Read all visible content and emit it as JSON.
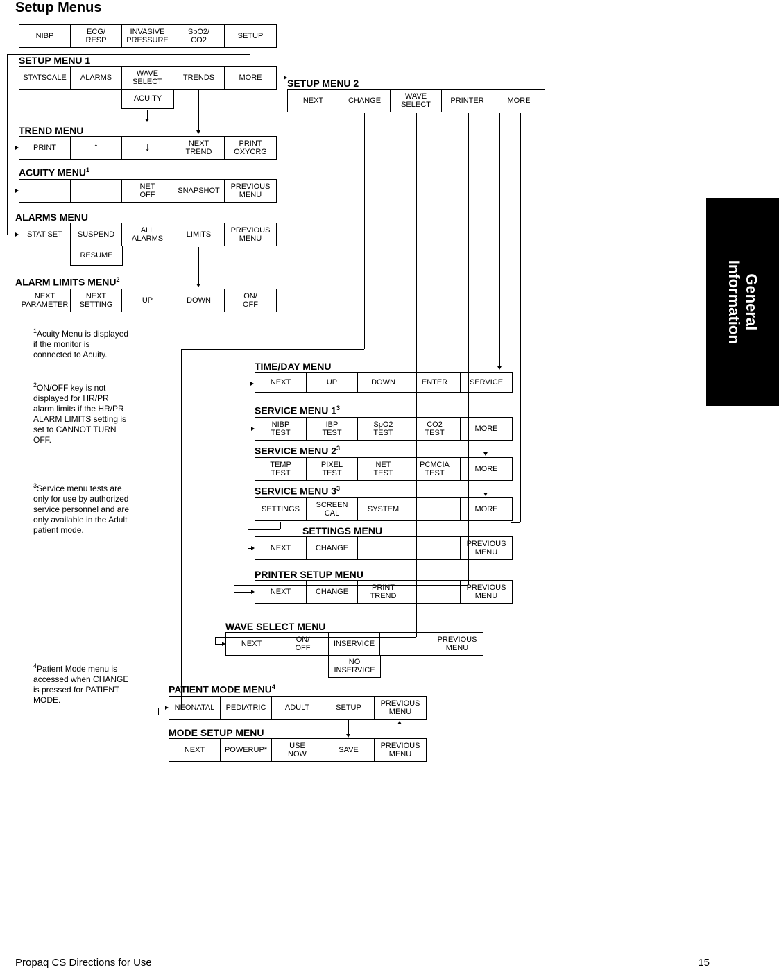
{
  "title": "Setup Menus",
  "sidebar": {
    "line1": "General",
    "line2": "Information"
  },
  "top_menu": {
    "items": [
      "NIBP",
      "ECG/\nRESP",
      "INVASIVE\nPRESSURE",
      "SpO2/\nCO2",
      "SETUP"
    ]
  },
  "setup_menu_1": {
    "header": "SETUP MENU 1",
    "items": [
      "STATSCALE",
      "ALARMS",
      "WAVE\nSELECT",
      "TRENDS",
      "MORE"
    ],
    "sub_item": "ACUITY"
  },
  "setup_menu_2": {
    "header": "SETUP MENU 2",
    "items": [
      "NEXT",
      "CHANGE",
      "WAVE\nSELECT",
      "PRINTER",
      "MORE"
    ]
  },
  "trend_menu": {
    "header": "TREND MENU",
    "items": [
      "PRINT",
      "↑",
      "↓",
      "NEXT\nTREND",
      "PRINT\nOXYCRG"
    ]
  },
  "acuity_menu": {
    "header_pre": "ACUITY MENU",
    "header_sup": "1",
    "items": [
      "",
      "",
      "NET\nOFF",
      "SNAPSHOT",
      "PREVIOUS\nMENU"
    ]
  },
  "alarms_menu": {
    "header": "ALARMS MENU",
    "items": [
      "STAT SET",
      "SUSPEND",
      "ALL\nALARMS",
      "LIMITS",
      "PREVIOUS\nMENU"
    ],
    "sub_item": "RESUME"
  },
  "alarm_limits_menu": {
    "header_pre": "ALARM LIMITS MENU",
    "header_sup": "2",
    "items": [
      "NEXT\nPARAMETER",
      "NEXT\nSETTING",
      "UP",
      "DOWN",
      "ON/\nOFF"
    ]
  },
  "time_day_menu": {
    "header": "TIME/DAY MENU",
    "items": [
      "NEXT",
      "UP",
      "DOWN",
      "ENTER",
      "SERVICE"
    ]
  },
  "service_menu_1": {
    "header_pre": "SERVICE MENU 1",
    "header_sup": "3",
    "items": [
      "NIBP\nTEST",
      "IBP\nTEST",
      "SpO2\nTEST",
      "CO2\nTEST",
      "MORE"
    ]
  },
  "service_menu_2": {
    "header_pre": "SERVICE MENU 2",
    "header_sup": "3",
    "items": [
      "TEMP\nTEST",
      "PIXEL\nTEST",
      "NET\nTEST",
      "PCMCIA\nTEST",
      "MORE"
    ]
  },
  "service_menu_3": {
    "header_pre": "SERVICE MENU 3",
    "header_sup": "3",
    "items": [
      "SETTINGS",
      "SCREEN\nCAL",
      "SYSTEM",
      "",
      "MORE"
    ]
  },
  "settings_menu": {
    "header": "SETTINGS MENU",
    "items": [
      "NEXT",
      "CHANGE",
      "",
      "",
      "PREVIOUS\nMENU"
    ]
  },
  "printer_setup_menu": {
    "header": "PRINTER SETUP MENU",
    "items": [
      "NEXT",
      "CHANGE",
      "PRINT\nTREND",
      "",
      "PREVIOUS\nMENU"
    ]
  },
  "wave_select_menu": {
    "header": "WAVE SELECT MENU",
    "items": [
      "NEXT",
      "ON/\nOFF",
      "INSERVICE",
      "",
      "PREVIOUS\nMENU"
    ],
    "sub_item": "NO\nINSERVICE"
  },
  "patient_mode_menu": {
    "header_pre": "PATIENT MODE MENU",
    "header_sup": "4",
    "items": [
      "NEONATAL",
      "PEDIATRIC",
      "ADULT",
      "SETUP",
      "PREVIOUS\nMENU"
    ]
  },
  "mode_setup_menu": {
    "header": "MODE SETUP MENU",
    "items": [
      "NEXT",
      "POWERUP*",
      "USE\nNOW",
      "SAVE",
      "PREVIOUS\nMENU"
    ]
  },
  "notes": {
    "n1_sup": "1",
    "n1": "Acuity Menu is displayed if the monitor is connected to Acuity.",
    "n2_sup": "2",
    "n2": "ON/OFF key is not displayed for HR/PR alarm limits if the HR/PR ALARM LIMITS setting is set to CANNOT TURN OFF.",
    "n3_sup": "3",
    "n3": "Service menu tests are only for use by authorized service personnel and are only available in the Adult patient mode.",
    "n4_sup": "4",
    "n4": "Patient Mode menu is accessed when CHANGE is pressed for PATIENT MODE."
  },
  "footer": {
    "left": "Propaq CS Directions for Use",
    "right": "15"
  }
}
